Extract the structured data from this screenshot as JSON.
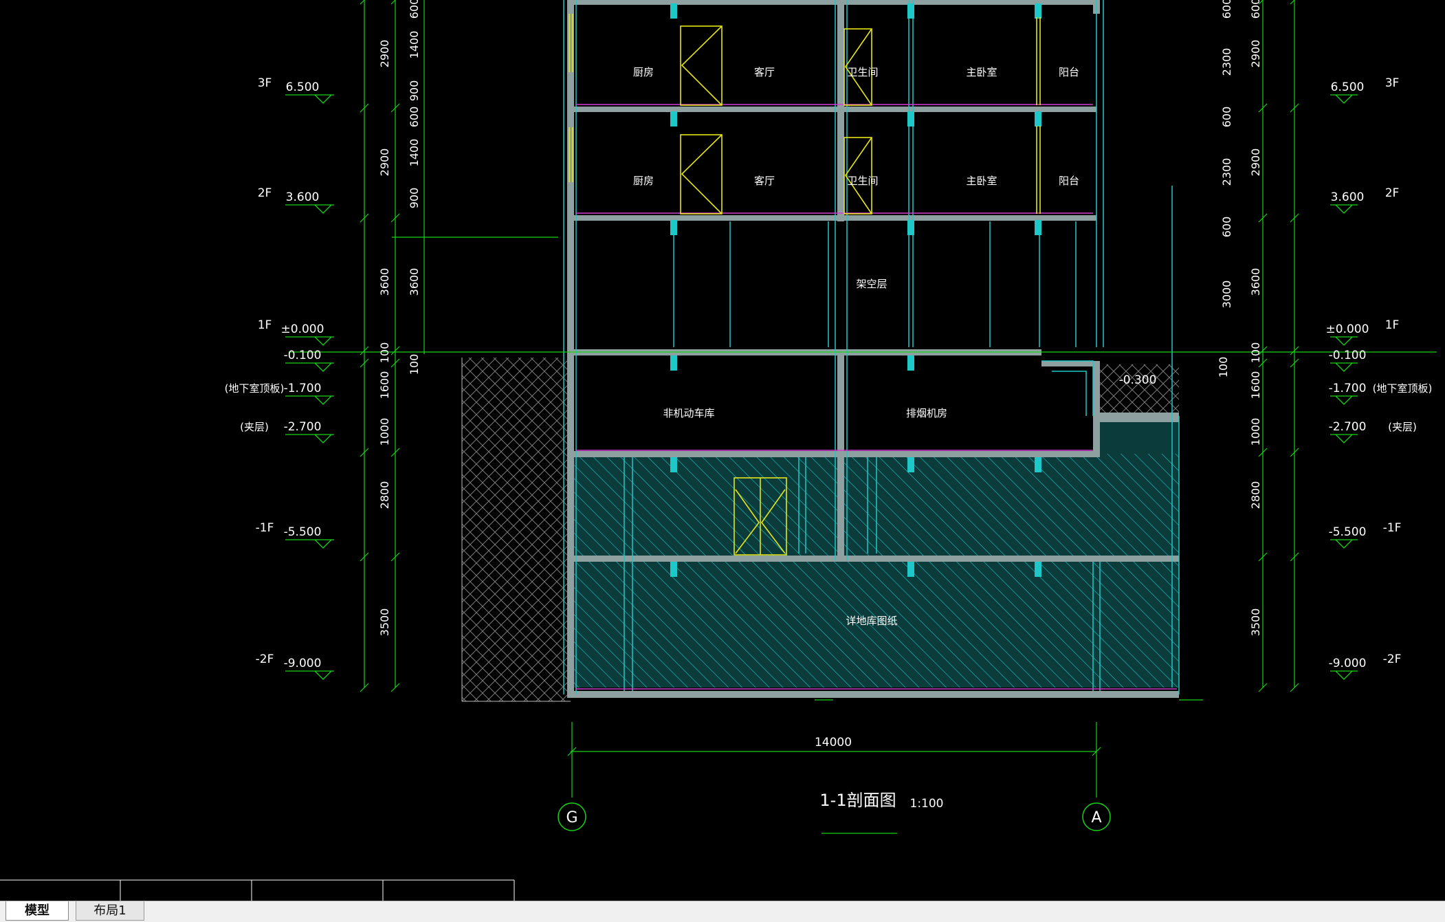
{
  "drawing": {
    "title": "1-1剖面图",
    "scale": "1:100",
    "axis_left": "G",
    "axis_right": "A",
    "overall_width": "14000",
    "colors": {
      "background": "#000000",
      "wall": "#8ea0a0",
      "cyan": "#1fc8c8",
      "green": "#17d317",
      "yellow": "#e6e619",
      "white": "#ffffff",
      "magenta": "#d23cd2",
      "grey": "#9a9a9a"
    },
    "rooms": {
      "f3": [
        "厨房",
        "客厅",
        "卫生间",
        "主卧室",
        "阳台"
      ],
      "f2": [
        "厨房",
        "客厅",
        "卫生间",
        "主卧室",
        "阳台"
      ],
      "f1": "架空层",
      "b1": [
        "非机动车库",
        "排烟机房"
      ],
      "b2": "详地库图纸"
    },
    "levels_left": [
      {
        "floor": "3F",
        "elev": "6.500",
        "note": ""
      },
      {
        "floor": "2F",
        "elev": "3.600",
        "note": ""
      },
      {
        "floor": "1F",
        "elev": "±0.000",
        "note": ""
      },
      {
        "floor": "",
        "elev": "-0.100",
        "note": ""
      },
      {
        "floor": "",
        "elev": "-1.700",
        "note": "(地下室顶板)"
      },
      {
        "floor": "",
        "elev": "-2.700",
        "note": "(夹层)"
      },
      {
        "floor": "-1F",
        "elev": "-5.500",
        "note": ""
      },
      {
        "floor": "-2F",
        "elev": "-9.000",
        "note": ""
      }
    ],
    "levels_right": [
      {
        "floor": "3F",
        "elev": "6.500",
        "note": ""
      },
      {
        "floor": "2F",
        "elev": "3.600",
        "note": ""
      },
      {
        "floor": "1F",
        "elev": "±0.000",
        "note": ""
      },
      {
        "floor": "",
        "elev": "-0.100",
        "note": ""
      },
      {
        "floor": "",
        "elev": "-1.700",
        "note": "(地下室顶板)"
      },
      {
        "floor": "",
        "elev": "-2.700",
        "note": "(夹层)"
      },
      {
        "floor": "-1F",
        "elev": "-5.500",
        "note": ""
      },
      {
        "floor": "-2F",
        "elev": "-9.000",
        "note": ""
      }
    ],
    "special_elev": "-0.300",
    "dims_left_outer": [
      "2900",
      "2900",
      "3600",
      "1600",
      "1000",
      "2800",
      "3500"
    ],
    "dims_left_inner": [
      "600",
      "1400",
      "900",
      "600",
      "1400",
      "900",
      "3600",
      "100",
      "100"
    ],
    "dims_right_inner": [
      "600",
      "2300",
      "600",
      "2300",
      "600",
      "3000",
      "100"
    ],
    "dims_right_outer": [
      "600",
      "2900",
      "2900",
      "3600",
      "100",
      "1600",
      "1000",
      "2800",
      "3500"
    ]
  },
  "tabs": {
    "model": "模型",
    "layout1": "布局1"
  }
}
